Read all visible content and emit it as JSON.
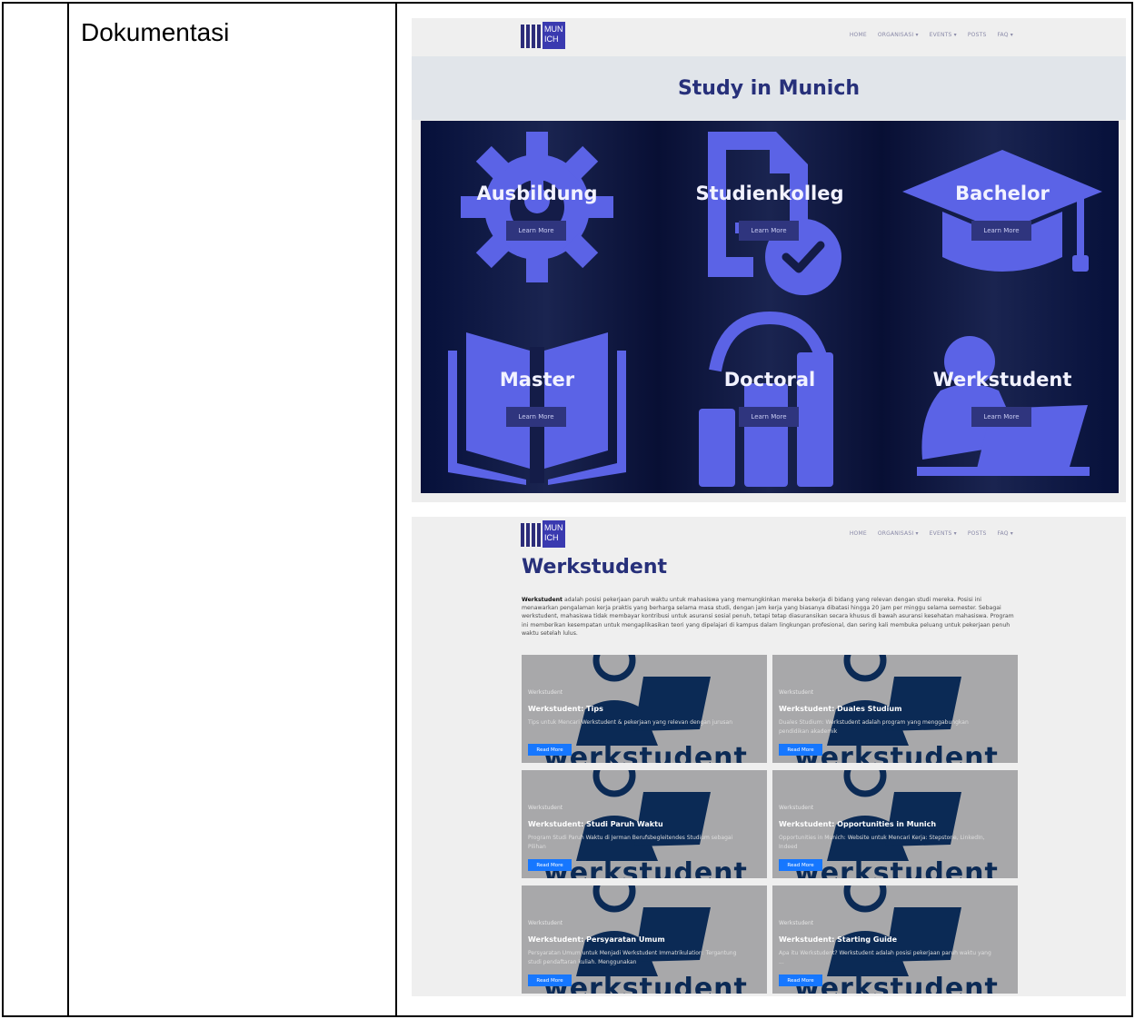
{
  "document": {
    "label": "Dokumentasi"
  },
  "nav": {
    "items": [
      "HOME",
      "ORGANISASI ▾",
      "EVENTS ▾",
      "POSTS",
      "FAQ ▾"
    ],
    "logo_text": [
      "MUN",
      "ICH"
    ]
  },
  "study_page": {
    "title": "Study in Munich",
    "cards": [
      {
        "title": "Ausbildung",
        "button": "Learn More",
        "icon": "gear-icon"
      },
      {
        "title": "Studienkolleg",
        "button": "Learn More",
        "icon": "document-check-icon"
      },
      {
        "title": "Bachelor",
        "button": "Learn More",
        "icon": "graduation-cap-icon"
      },
      {
        "title": "Master",
        "button": "Learn More",
        "icon": "open-book-icon"
      },
      {
        "title": "Doctoral",
        "button": "Learn More",
        "icon": "bar-chart-icon"
      },
      {
        "title": "Werkstudent",
        "button": "Learn More",
        "icon": "person-laptop-icon"
      }
    ],
    "colors": {
      "accent": "#5b63e6",
      "background": "#0a1338",
      "title": "#27307a"
    }
  },
  "werkstudent_page": {
    "title": "Werkstudent",
    "description_bold": "Werkstudent",
    "description": " adalah posisi pekerjaan paruh waktu untuk mahasiswa yang memungkinkan mereka bekerja di bidang yang relevan dengan studi mereka. Posisi ini menawarkan pengalaman kerja praktis yang berharga selama masa studi, dengan jam kerja yang biasanya dibatasi hingga 20 jam per minggu selama semester. Sebagai werkstudent, mahasiswa tidak membayar kontribusi untuk asuransi sosial penuh, tetapi tetap diasuransikan secara khusus di bawah asuransi kesehatan mahasiswa. Program ini memberikan kesempatan untuk mengaplikasikan teori yang dipelajari di kampus dalam lingkungan profesional, dan sering kali membuka peluang untuk pekerjaan penuh waktu setelah lulus.",
    "posts": [
      {
        "category": "Werkstudent",
        "title": "Werkstudent: Tips",
        "excerpt": "Tips untuk Mencari Werkstudent & pekerjaan yang relevan dengan jurusan",
        "button": "Read More",
        "watermark": "werkstudent"
      },
      {
        "category": "Werkstudent",
        "title": "Werkstudent: Duales Studium",
        "excerpt": "Duales Studium: Werkstudent adalah program yang menggabungkan pendidikan akademik",
        "button": "Read More",
        "watermark": "werkstudent"
      },
      {
        "category": "Werkstudent",
        "title": "Werkstudent: Studi Paruh Waktu",
        "excerpt": "Program Studi Paruh Waktu di Jerman Berufsbegleitendes Studium sebagai Pilihan",
        "button": "Read More",
        "watermark": "werkstudent"
      },
      {
        "category": "Werkstudent",
        "title": "Werkstudent: Opportunities in Munich",
        "excerpt": "Opportunities in Munich: Website untuk Mencari Kerja: Stepstone, LinkedIn, Indeed",
        "button": "Read More",
        "watermark": "werkstudent"
      },
      {
        "category": "Werkstudent",
        "title": "Werkstudent: Persyaratan Umum",
        "excerpt": "Persyaratan Umum untuk Menjadi Werkstudent Immatrikulation: Tergantung studi pendaftaran kuliah. Menggunakan",
        "button": "Read More",
        "watermark": "werkstudent"
      },
      {
        "category": "Werkstudent",
        "title": "Werkstudent: Starting Guide",
        "excerpt": "Apa itu Werkstudent? Werkstudent adalah posisi pekerjaan paruh waktu yang ...",
        "button": "Read More",
        "watermark": "werkstudent"
      }
    ]
  }
}
